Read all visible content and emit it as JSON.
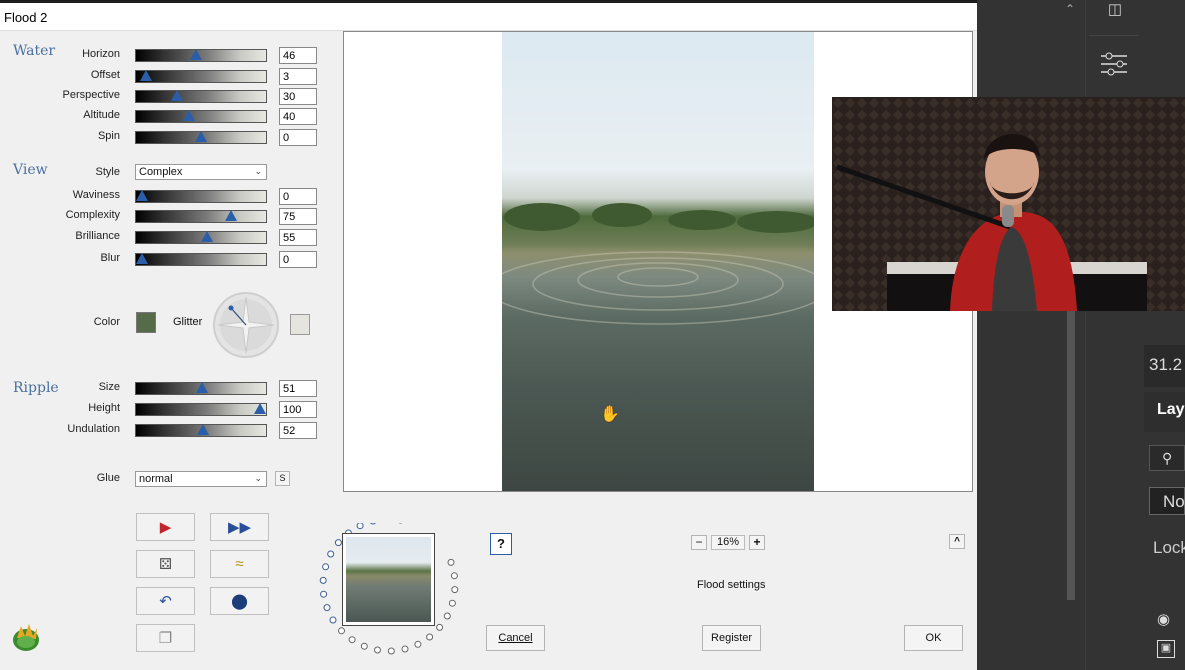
{
  "dialog": {
    "title": "Flood 2"
  },
  "water": {
    "heading": "Water",
    "sliders": [
      {
        "label": "Horizon",
        "value": "46",
        "level": 46
      },
      {
        "label": "Offset",
        "value": "3",
        "level": 3
      },
      {
        "label": "Perspective",
        "value": "30",
        "level": 30
      },
      {
        "label": "Altitude",
        "value": "40",
        "level": 40
      },
      {
        "label": "Spin",
        "value": "0",
        "level": 50
      }
    ]
  },
  "view": {
    "heading": "View",
    "style_label": "Style",
    "style_value": "Complex",
    "sliders": [
      {
        "label": "Waviness",
        "value": "0",
        "level": 0
      },
      {
        "label": "Complexity",
        "value": "75",
        "level": 75
      },
      {
        "label": "Brilliance",
        "value": "55",
        "level": 55
      },
      {
        "label": "Blur",
        "value": "0",
        "level": 0
      }
    ],
    "color_label": "Color",
    "color_value": "#556b4a",
    "glitter_label": "Glitter",
    "glitter_color": "#e6e4de"
  },
  "ripple": {
    "heading": "Ripple",
    "sliders": [
      {
        "label": "Size",
        "value": "51",
        "level": 51
      },
      {
        "label": "Height",
        "value": "100",
        "level": 100
      },
      {
        "label": "Undulation",
        "value": "52",
        "level": 52
      }
    ]
  },
  "glue": {
    "label": "Glue",
    "value": "normal",
    "s_button": "S"
  },
  "zoom": {
    "minus": "−",
    "value": "16%",
    "plus": "+"
  },
  "status": "Flood settings",
  "help_label": "?",
  "collapse_label": "^",
  "buttons": {
    "cancel": "Cancel",
    "register": "Register",
    "ok": "OK"
  },
  "right_panel": {
    "field_value": "31.2",
    "layers_label": "Lay",
    "blend_label": "No",
    "lock_label": "Lock"
  }
}
